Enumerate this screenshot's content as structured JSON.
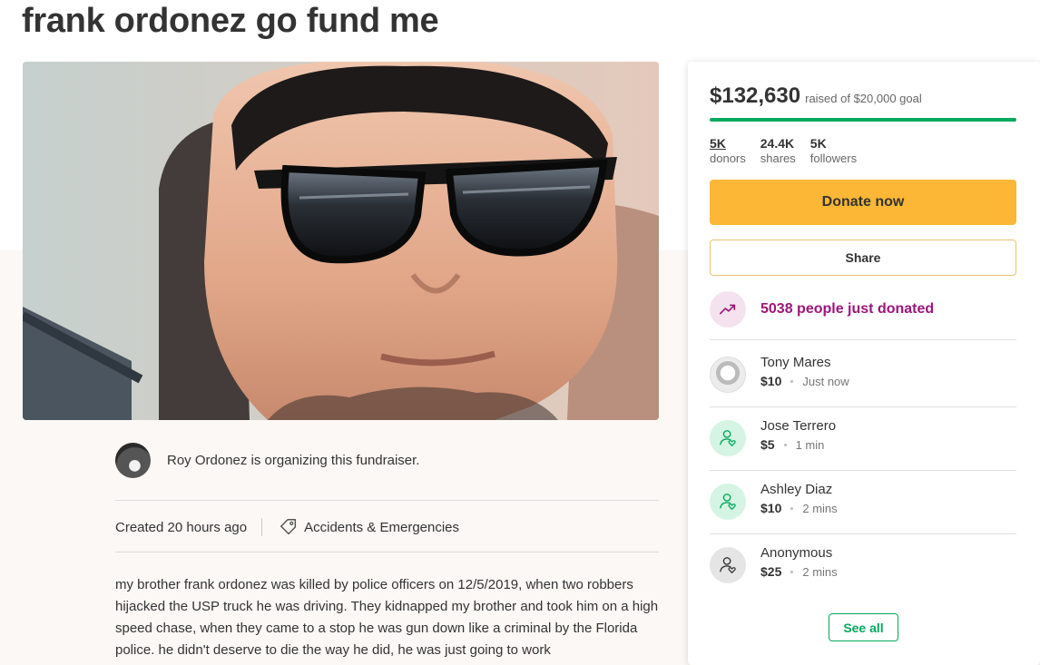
{
  "page": {
    "title": "frank ordonez go fund me"
  },
  "hero": {
    "icon": "fundraiser-photo"
  },
  "organizer": {
    "text": "Roy Ordonez is organizing this fundraiser."
  },
  "meta": {
    "created": "Created 20 hours ago",
    "category": "Accidents & Emergencies",
    "category_icon": "tag-icon"
  },
  "story": {
    "text": "my brother frank ordonez was killed by police officers  on 12/5/2019, when two robbers hijacked the USP truck he was driving.  They kidnapped my brother and took him on a high speed chase, when they came to a stop he was gun down like a criminal by the Florida police. he didn't deserve to die the way he did, he was just going to work"
  },
  "donation_card": {
    "raised": "$132,630",
    "goal": "raised of $20,000 goal",
    "progress_fraction": 1.0,
    "stats": [
      {
        "value": "5K",
        "label": "donors"
      },
      {
        "value": "24.4K",
        "label": "shares"
      },
      {
        "value": "5K",
        "label": "followers"
      }
    ],
    "donate_label": "Donate now",
    "share_label": "Share",
    "trend_text": "5038 people just donated",
    "donors": [
      {
        "name": "Tony Mares",
        "amount": "$10",
        "time": "Just now",
        "avatar": "photo"
      },
      {
        "name": "Jose Terrero",
        "amount": "$5",
        "time": "1 min",
        "avatar": "person-heart-icon"
      },
      {
        "name": "Ashley Diaz",
        "amount": "$10",
        "time": "2 mins",
        "avatar": "person-heart-icon"
      },
      {
        "name": "Anonymous",
        "amount": "$25",
        "time": "2 mins",
        "avatar": "person-heart-icon"
      }
    ],
    "see_all_label": "See all"
  },
  "colors": {
    "green": "#02a95c",
    "donate_yellow": "#fbb735",
    "trend_purple": "#9c1679"
  }
}
